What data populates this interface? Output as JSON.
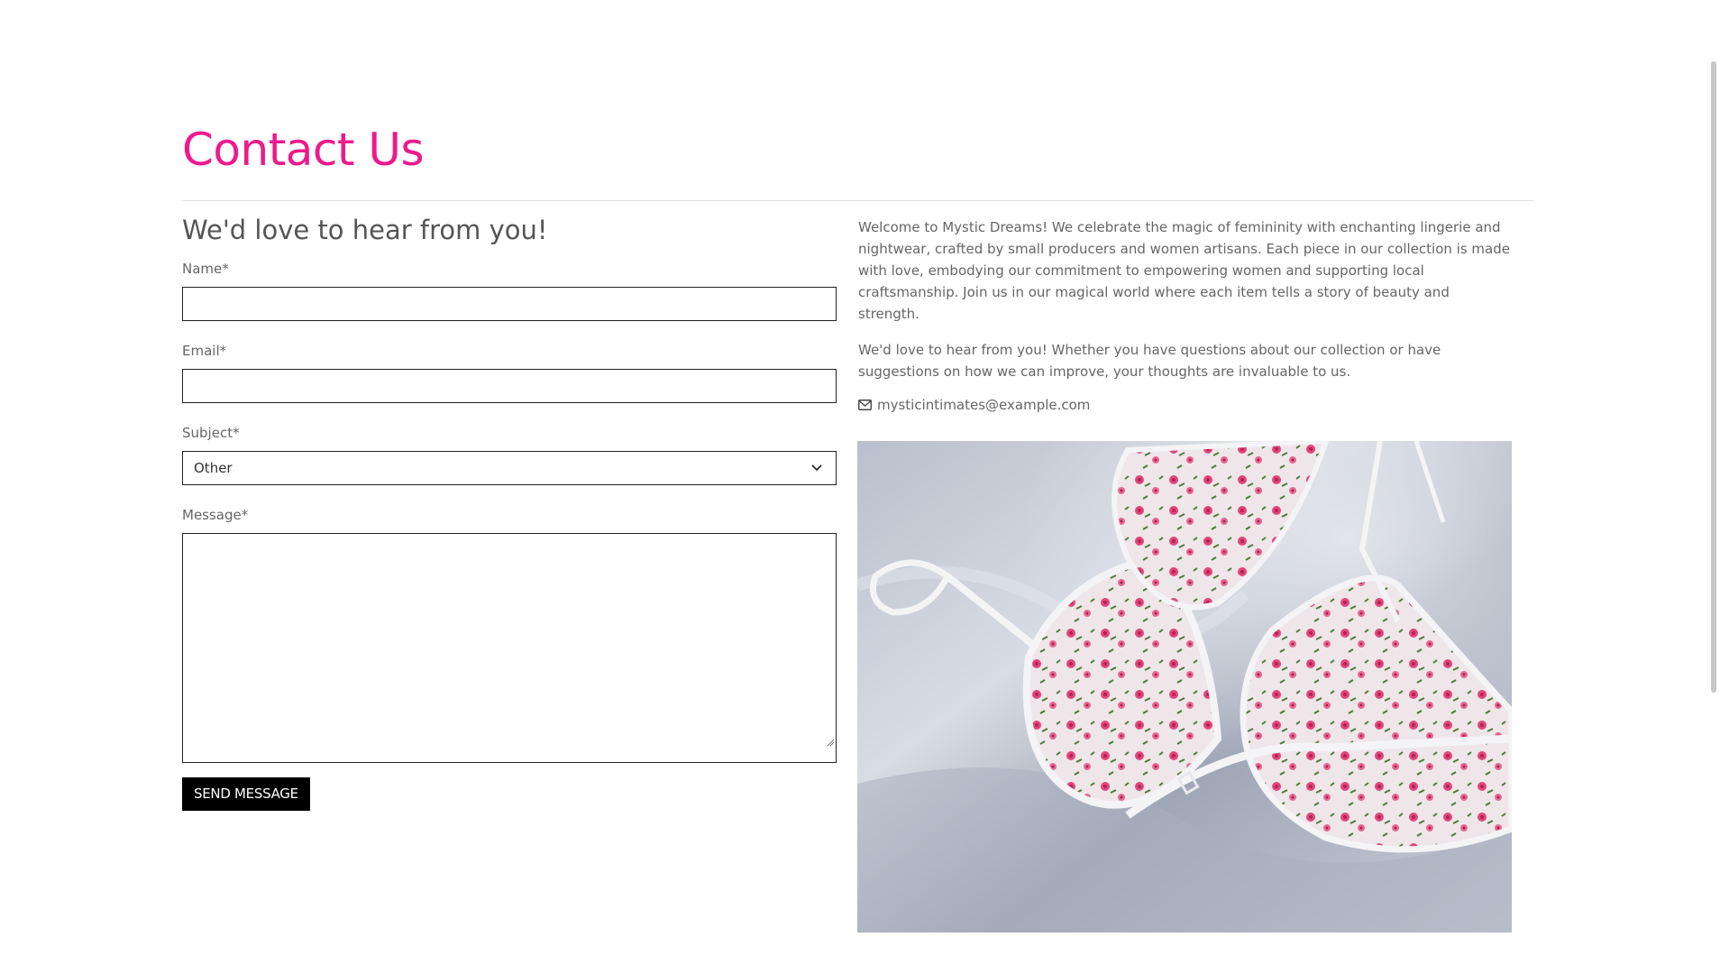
{
  "page": {
    "title": "Contact Us",
    "subtitle": "We'd love to hear from you!"
  },
  "form": {
    "name_label": "Name*",
    "email_label": "Email*",
    "subject_label": "Subject*",
    "subject_value": "Other",
    "message_label": "Message*",
    "send_label": "SEND MESSAGE"
  },
  "info": {
    "paragraph1": "Welcome to Mystic Dreams! We celebrate the magic of femininity with enchanting lingerie and nightwear, crafted by small producers and women artisans. Each piece in our collection is made with love, embodying our commitment to empowering women and supporting local craftsmanship. Join us in our magical world where each item tells a story of beauty and strength.",
    "paragraph2": "We'd love to hear from you! Whether you have questions about our collection or have suggestions on how we can improve, your thoughts are invaluable to us.",
    "email": "mysticintimates@example.com",
    "email_icon": "envelope-icon"
  },
  "colors": {
    "accent": "#ee1a8c",
    "button_bg": "#000000",
    "text": "#666666"
  }
}
